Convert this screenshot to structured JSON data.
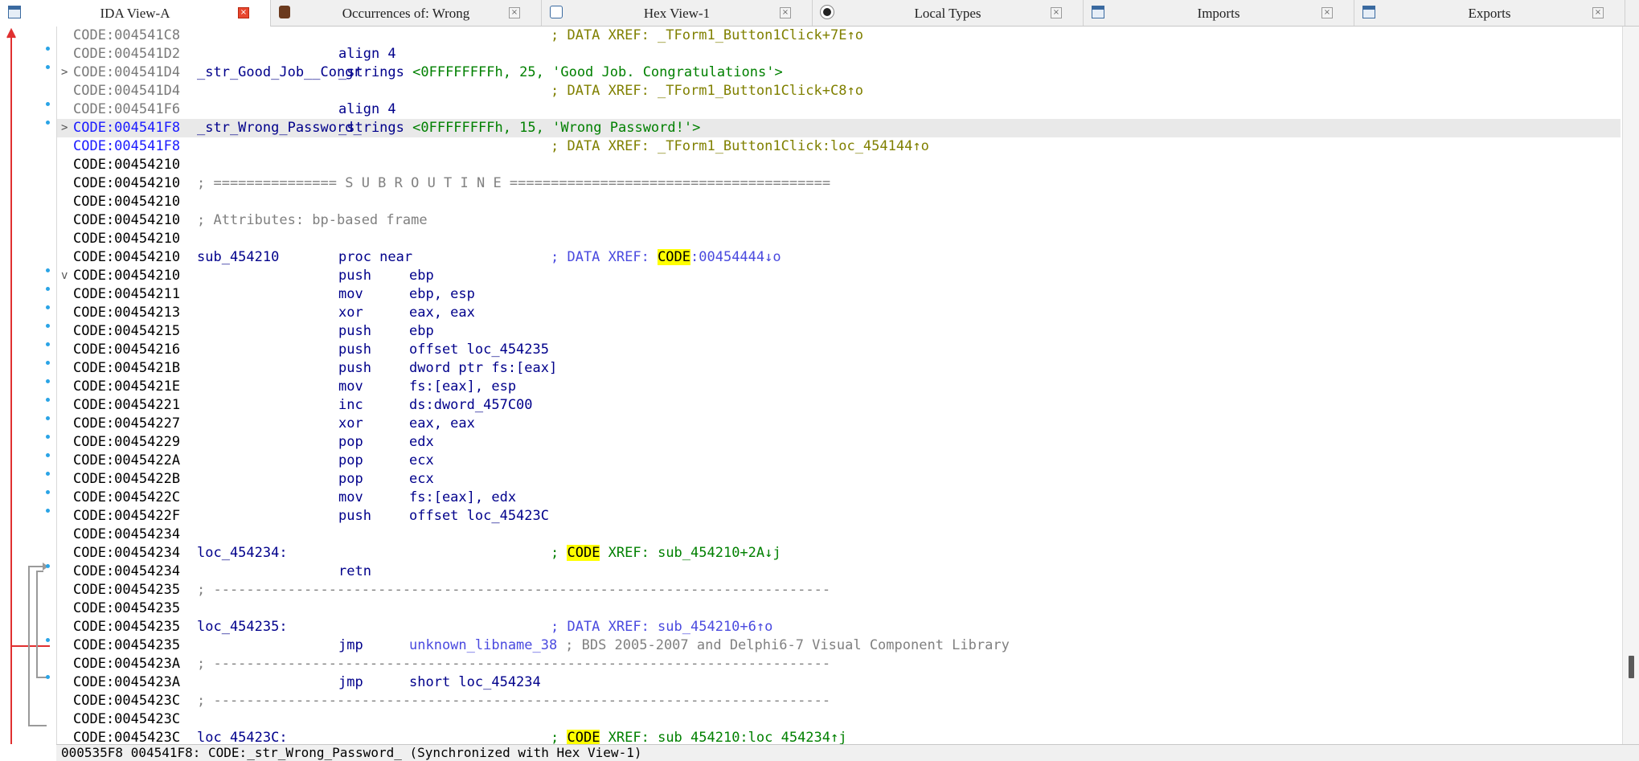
{
  "tabs": [
    {
      "label": "IDA View-A",
      "icon": "ida-view-icon",
      "active": true
    },
    {
      "label": "Occurrences of: Wrong",
      "icon": "occurrences-icon",
      "active": false
    },
    {
      "label": "Hex View-1",
      "icon": "hex-view-icon",
      "active": false
    },
    {
      "label": "Local Types",
      "icon": "local-types-icon",
      "active": false
    },
    {
      "label": "Imports",
      "icon": "imports-icon",
      "active": false
    },
    {
      "label": "Exports",
      "icon": "exports-icon",
      "active": false
    }
  ],
  "close_glyph": "×",
  "fold_glyphs": {
    "collapsed": ">",
    "expanded": "v"
  },
  "lines": [
    {
      "addr": "CODE:004541C8",
      "addr_style": "gray",
      "comment": "; DATA XREF: _TForm1_Button1Click+7E↑o",
      "comment_style": "olive"
    },
    {
      "addr": "CODE:004541D2",
      "addr_style": "gray",
      "mnem": "align 4"
    },
    {
      "addr": "CODE:004541D4",
      "addr_style": "gray",
      "fold": "collapsed",
      "label": "_str_Good_Job__Congr",
      "op_text": "_strings <0FFFFFFFFh, 25, 'Good Job. Congratulations'>"
    },
    {
      "addr": "CODE:004541D4",
      "addr_style": "gray",
      "comment": "; DATA XREF: _TForm1_Button1Click+C8↑o",
      "comment_style": "olive"
    },
    {
      "addr": "CODE:004541F6",
      "addr_style": "gray",
      "mnem": "align 4"
    },
    {
      "addr": "CODE:004541F8",
      "addr_style": "blue",
      "fold": "collapsed",
      "highlight": true,
      "label": "_str_Wrong_Password_",
      "op_text": "_strings <0FFFFFFFFh, 15, 'Wrong Password!'>"
    },
    {
      "addr": "CODE:004541F8",
      "addr_style": "blue",
      "comment": "; DATA XREF: _TForm1_Button1Click:loc_454144↑o",
      "comment_style": "olive"
    },
    {
      "addr": "CODE:00454210"
    },
    {
      "addr": "CODE:00454210",
      "raw": "; =============== S U B R O U T I N E =======================================",
      "raw_style": "gray2"
    },
    {
      "addr": "CODE:00454210"
    },
    {
      "addr": "CODE:00454210",
      "raw": "; Attributes: bp-based frame",
      "raw_style": "gray2"
    },
    {
      "addr": "CODE:00454210"
    },
    {
      "addr": "CODE:00454210",
      "label": "sub_454210",
      "mnem": "proc near",
      "xref": {
        "pre": "; DATA XREF: ",
        "mark": "CODE",
        "post": ":00454444↓o",
        "style": "xlink"
      }
    },
    {
      "addr": "CODE:00454210",
      "fold": "expanded",
      "mnem": "push",
      "op": "ebp"
    },
    {
      "addr": "CODE:00454211",
      "mnem": "mov",
      "op": "ebp, esp"
    },
    {
      "addr": "CODE:00454213",
      "mnem": "xor",
      "op": "eax, eax"
    },
    {
      "addr": "CODE:00454215",
      "mnem": "push",
      "op": "ebp"
    },
    {
      "addr": "CODE:00454216",
      "mnem": "push",
      "op": "offset loc_454235"
    },
    {
      "addr": "CODE:0045421B",
      "mnem": "push",
      "op": "dword ptr fs:[eax]"
    },
    {
      "addr": "CODE:0045421E",
      "mnem": "mov",
      "op": "fs:[eax], esp"
    },
    {
      "addr": "CODE:00454221",
      "mnem": "inc",
      "op": "ds:dword_457C00"
    },
    {
      "addr": "CODE:00454227",
      "mnem": "xor",
      "op": "eax, eax"
    },
    {
      "addr": "CODE:00454229",
      "mnem": "pop",
      "op": "edx"
    },
    {
      "addr": "CODE:0045422A",
      "mnem": "pop",
      "op": "ecx"
    },
    {
      "addr": "CODE:0045422B",
      "mnem": "pop",
      "op": "ecx"
    },
    {
      "addr": "CODE:0045422C",
      "mnem": "mov",
      "op": "fs:[eax], edx"
    },
    {
      "addr": "CODE:0045422F",
      "mnem": "push",
      "op": "offset loc_45423C"
    },
    {
      "addr": "CODE:00454234"
    },
    {
      "addr": "CODE:00454234",
      "label": "loc_454234:",
      "xref": {
        "pre": "; ",
        "mark": "CODE",
        "post": " XREF: sub_454210+2A↓j",
        "style": "green"
      }
    },
    {
      "addr": "CODE:00454234",
      "mnem": "retn"
    },
    {
      "addr": "CODE:00454235",
      "raw": "; ---------------------------------------------------------------------------",
      "raw_style": "gray2"
    },
    {
      "addr": "CODE:00454235"
    },
    {
      "addr": "CODE:00454235",
      "label": "loc_454235:",
      "comment": "; DATA XREF: sub_454210+6↑o",
      "comment_style": "xlink"
    },
    {
      "addr": "CODE:00454235",
      "mnem": "jmp",
      "op_lib": "unknown_libname_38",
      "lib_comment": "; BDS 2005-2007 and Delphi6-7 Visual Component Library"
    },
    {
      "addr": "CODE:0045423A",
      "raw": "; ---------------------------------------------------------------------------",
      "raw_style": "gray2"
    },
    {
      "addr": "CODE:0045423A",
      "mnem": "jmp",
      "op": "short loc_454234"
    },
    {
      "addr": "CODE:0045423C",
      "raw": "; ---------------------------------------------------------------------------",
      "raw_style": "gray2"
    },
    {
      "addr": "CODE:0045423C"
    },
    {
      "addr": "CODE:0045423C",
      "label": "loc_45423C:",
      "xref": {
        "pre": "; ",
        "mark": "CODE",
        "post": " XREF: sub_454210:loc_454234↑j",
        "style": "green"
      }
    }
  ],
  "breakpoint_dot_lines": [
    1,
    2,
    4,
    5,
    13,
    14,
    15,
    16,
    17,
    18,
    19,
    20,
    21,
    22,
    23,
    24,
    25,
    26,
    29,
    33,
    35
  ],
  "status": {
    "text": "000535F8 004541F8: CODE:_str_Wrong_Password_ (Synchronized with Hex View-1)"
  },
  "colors": {
    "accent_close_active": "#e8462e",
    "breakpoint_dot": "#2aa4e6",
    "arrow_red": "#e03030",
    "highlight_row": "#e9e9e9",
    "xref_mark": "#ffff00"
  }
}
